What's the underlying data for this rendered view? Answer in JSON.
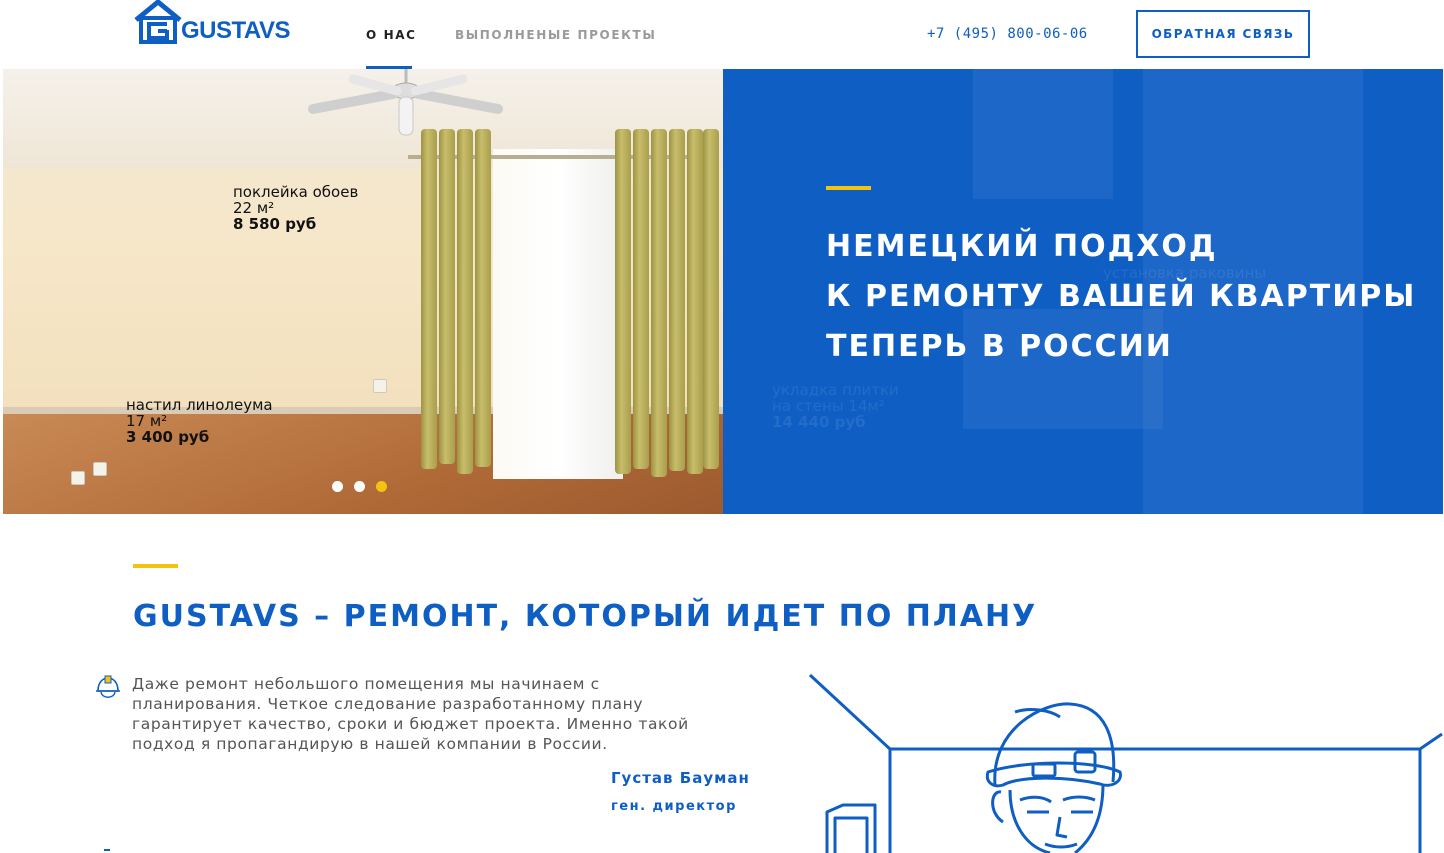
{
  "header": {
    "logo_text": "GUSTAVS",
    "nav": [
      {
        "label": "О НАС"
      },
      {
        "label": "ВЫПОЛНЕНЫЕ ПРОЕКТЫ"
      }
    ],
    "phone": "+7 (495) 800-06-06",
    "feedback_label": "ОБРАТНАЯ СВЯЗЬ"
  },
  "hero": {
    "labels": [
      {
        "line1": "поклейка обоев",
        "line2": "22 м²",
        "line3": "8 580 руб"
      },
      {
        "line1": "настил линолеума",
        "line2": "17 м²",
        "line3": "3 400 руб"
      }
    ],
    "ghost_labels": [
      {
        "line1": "установка раковины"
      },
      {
        "line1": "укладка плитки",
        "line2": "на стены 14м²",
        "line3": "14 440 руб"
      }
    ],
    "title_lines": [
      "НЕМЕЦКИЙ ПОДХОД",
      "К РЕМОНТУ ВАШЕЙ КВАРТИРЫ",
      "ТЕПЕРЬ В РОССИИ"
    ],
    "slider": {
      "count": 3,
      "active_index": 2
    }
  },
  "about": {
    "title": "GUSTAVS – РЕМОНТ, КОТОРЫЙ ИДЕТ ПО ПЛАНУ",
    "quote_lines": [
      "Даже ремонт небольшого помещения мы начинаем с",
      "планирования. Четкое следование разработанному плану",
      "гарантирует качество, сроки и бюджет проекта. Именно такой",
      "подход я пропагандирую в нашей компании в России."
    ],
    "author": "Густав Бауман",
    "author_role": "ген. директор"
  },
  "colors": {
    "brand_blue": "#0e5ec4",
    "accent_yellow": "#f2c30f",
    "text_gray": "#555555"
  },
  "icons": {
    "logo": "house-logo-icon",
    "quote": "hard-hat-icon"
  }
}
